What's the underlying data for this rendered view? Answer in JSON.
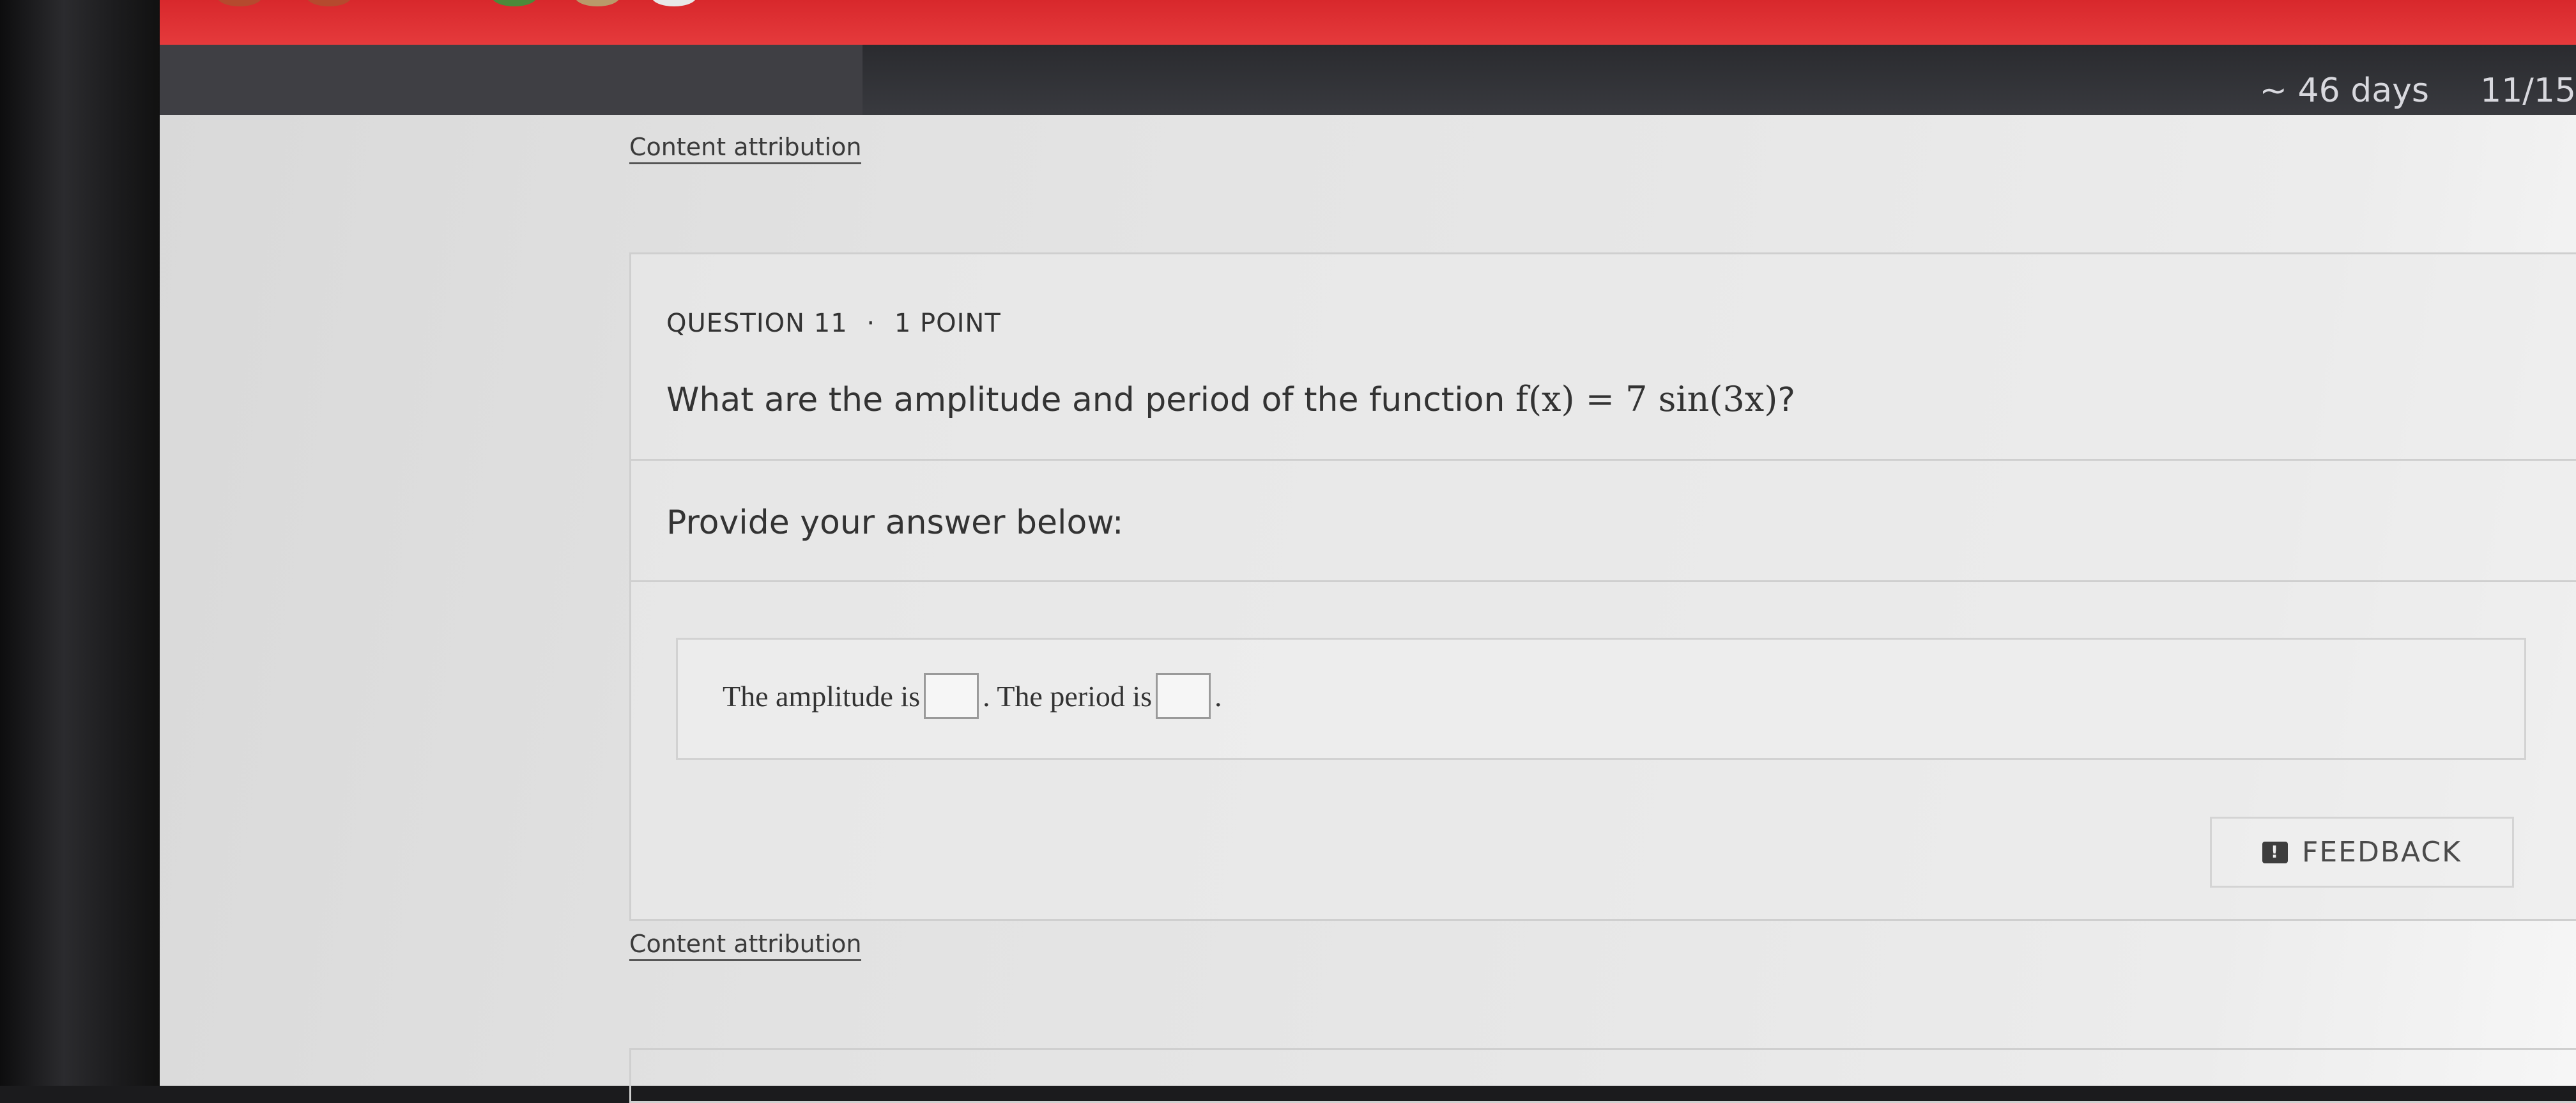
{
  "header": {
    "days_remaining": "~ 46 days",
    "progress": "11/15"
  },
  "attribution": {
    "top_label": "Content attribution",
    "bottom_label": "Content attribution"
  },
  "question": {
    "number_label": "QUESTION 11",
    "separator": "·",
    "points_label": "1 POINT",
    "text": "What are the amplitude and period of the function ",
    "math": "f(x) = 7 sin(3x)",
    "suffix": "?"
  },
  "answer": {
    "prompt": "Provide your answer below:",
    "amplitude_label": "The amplitude is",
    "amplitude_value": "",
    "period_label": ". The period is",
    "period_value": "",
    "end": "."
  },
  "feedback": {
    "icon": "exclamation-icon",
    "label": "FEEDBACK"
  },
  "colors": {
    "top_red": "#e53a3c",
    "topbar": "#3a3b40",
    "page_bg": "#e4e4e4"
  }
}
